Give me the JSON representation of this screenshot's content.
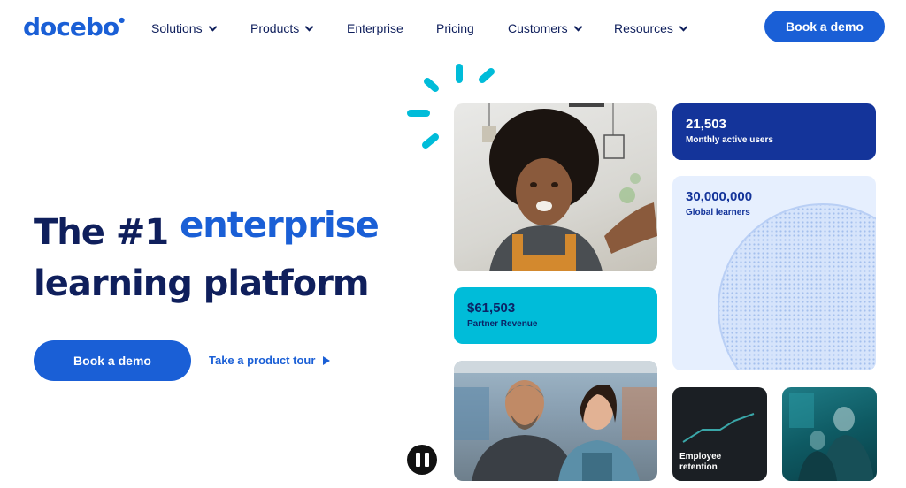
{
  "nav": {
    "logo": "docebo",
    "items": [
      {
        "label": "Solutions",
        "has_dropdown": true
      },
      {
        "label": "Products",
        "has_dropdown": true
      },
      {
        "label": "Enterprise",
        "has_dropdown": false
      },
      {
        "label": "Pricing",
        "has_dropdown": false
      },
      {
        "label": "Customers",
        "has_dropdown": true
      },
      {
        "label": "Resources",
        "has_dropdown": true
      }
    ],
    "cta": "Book a demo"
  },
  "hero": {
    "title_part1": "The #1",
    "title_accent": "enterprise",
    "title_line2": "learning platform",
    "primary_cta": "Book a demo",
    "secondary_cta": "Take a product tour"
  },
  "stats": {
    "users": {
      "value": "21,503",
      "label": "Monthly active users"
    },
    "learners": {
      "value": "30,000,000",
      "label": "Global learners"
    },
    "revenue": {
      "value": "$61,503",
      "label": "Partner Revenue"
    },
    "retention": {
      "label": "Employee retention"
    }
  },
  "icons": {
    "burst": "sparkle-burst-icon",
    "pause": "pause-icon",
    "play": "play-triangle-icon",
    "chevron": "chevron-down-icon"
  },
  "colors": {
    "brand_blue": "#1a5fd6",
    "navy": "#0f1f5c",
    "cyan": "#00bcd9",
    "dark_stat": "#14349a",
    "light_stat": "#e6effe"
  }
}
